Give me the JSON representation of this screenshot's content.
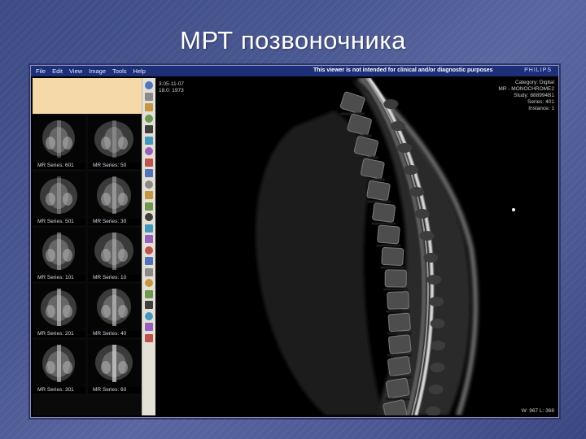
{
  "slide": {
    "title": "МРТ позвоночника"
  },
  "menu": {
    "items": [
      {
        "label": "File"
      },
      {
        "label": "Edit"
      },
      {
        "label": "View"
      },
      {
        "label": "Image"
      },
      {
        "label": "Tools"
      },
      {
        "label": "Help"
      }
    ],
    "disclaimer": "This viewer is not intended for clinical and/or diagnostic purposes",
    "brand": "PHILIPS"
  },
  "thumbnails": [
    {
      "label": "MR Series: 601"
    },
    {
      "label": "MR Series: 50"
    },
    {
      "label": "MR Series: 501"
    },
    {
      "label": "MR Series: 30"
    },
    {
      "label": "MR Series: 101"
    },
    {
      "label": "MR Series: 10"
    },
    {
      "label": "MR Series: 201"
    },
    {
      "label": "MR Series: 40"
    },
    {
      "label": "MR Series: 301"
    },
    {
      "label": "MR Series: 60"
    }
  ],
  "overlay": {
    "top_left": [
      "3.05-11-07",
      "18.0: 1973"
    ],
    "top_right": [
      "Category: Digital",
      "MR - MONOCHROME2",
      "Study: 888994B1",
      "Series: 401",
      "Instance: 1"
    ],
    "bottom_right": "W: 967  L: 368"
  },
  "tools": [
    "pointer-icon",
    "magnify-icon",
    "pan-icon",
    "window-level-icon",
    "invert-icon",
    "layout-icon",
    "measure-icon",
    "annotate-icon",
    "reset-icon",
    "print-icon",
    "export-icon",
    "save-icon",
    "clip-icon",
    "cine-icon",
    "play-icon",
    "rewind-icon",
    "stack-icon",
    "flip-icon",
    "rotate-icon",
    "help-icon",
    "line-icon",
    "angle-icon",
    "roi-icon",
    "text-icon"
  ]
}
